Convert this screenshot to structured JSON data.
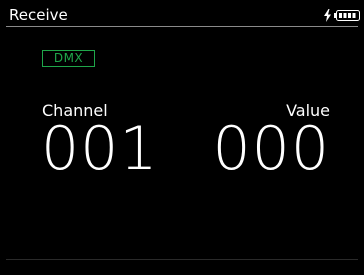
{
  "header": {
    "title": "Receive",
    "icons": [
      "bolt-icon",
      "battery-icon"
    ],
    "battery_level": 1.0
  },
  "mode": {
    "label": "DMX",
    "color": "#1fa64a"
  },
  "channel": {
    "label": "Channel",
    "value": "001"
  },
  "value": {
    "label": "Value",
    "value": "000"
  }
}
